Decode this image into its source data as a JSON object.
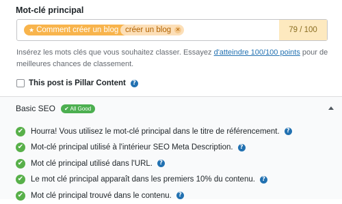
{
  "keyword_section": {
    "label": "Mot-clé principal",
    "keywords": [
      {
        "text": "Comment créer un blog",
        "icon": "star-icon",
        "type": "primary"
      },
      {
        "text": "créer un blog",
        "type": "secondary"
      }
    ],
    "remove_glyph": "✕",
    "star_glyph": "★",
    "score": "79 / 100",
    "hint_before": "Insérez les mots clés que vous souhaitez classer. Essayez ",
    "hint_link": "d'atteindre 100/100 points",
    "hint_after": " pour de meilleures chances de classement."
  },
  "pillar": {
    "label": "This post is Pillar Content",
    "checked": false,
    "help_glyph": "?"
  },
  "basic_seo": {
    "title": "Basic SEO",
    "badge": "✔ All Good",
    "collapse_icon": "caret-up-icon",
    "check_glyph": "✔",
    "help_glyph": "?",
    "checks": [
      "Hourra!  Vous utilisez le mot-clé principal dans le titre de référencement.",
      "Mot-clé principal utilisé à l'intérieur SEO Meta Description.",
      "Mot clé principal utilisé dans l'URL.",
      "Le mot clé principal apparaît dans les premiers 10% du contenu.",
      "Mot clé principal trouvé dans le contenu."
    ]
  },
  "colors": {
    "primary_tag": "#f8b44c",
    "secondary_tag": "#fcdfb8",
    "score_bg": "#fde9bf",
    "success": "#58b04a",
    "link": "#2271b1"
  }
}
